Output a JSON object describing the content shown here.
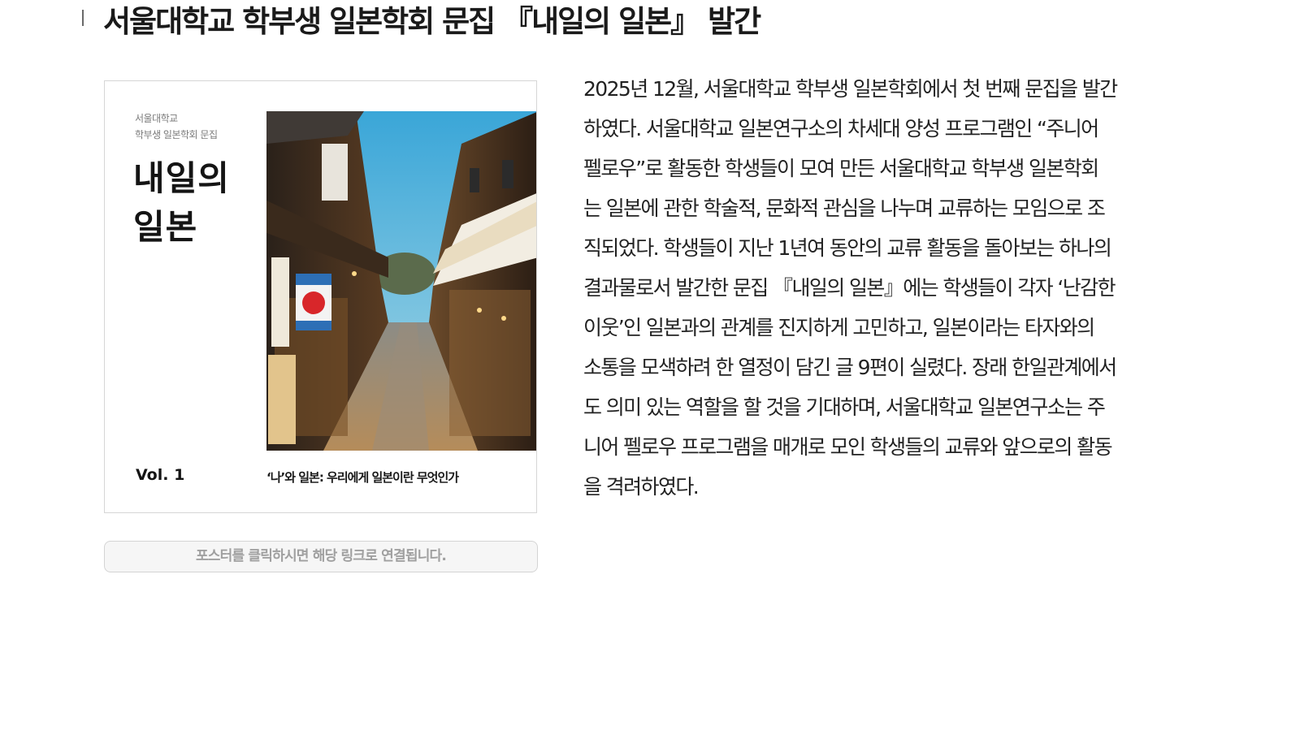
{
  "header": {
    "title": "서울대학교 학부생 일본학회 문집 『내일의 일본』 발간"
  },
  "poster": {
    "university": "서울대학교",
    "club": "학부생 일본학회 문집",
    "title_line1": "내일의",
    "title_line2": "일본",
    "volume": "Vol. 1",
    "subtitle": "‘나’와 일본: 우리에게 일본이란 무엇인가"
  },
  "caption": {
    "text": "포스터를 클릭하시면 해당 링크로 연결됩니다."
  },
  "article": {
    "lines": [
      "2025년 12월, 서울대학교 학부생 일본학회에서 첫 번째 문집을 발간",
      "하였다. 서울대학교 일본연구소의 차세대 양성 프로그램인 “주니어",
      "펠로우”로 활동한 학생들이 모여 만든 서울대학교 학부생 일본학회",
      "는 일본에 관한 학술적, 문화적 관심을 나누며 교류하는 모임으로 조",
      "직되었다. 학생들이 지난 1년여 동안의 교류 활동을 돌아보는 하나의",
      "결과물로서 발간한 문집 『내일의 일본』에는 학생들이 각자 ‘난감한",
      "이웃’인 일본과의 관계를 진지하게 고민하고, 일본이라는 타자와의",
      "소통을 모색하려 한 열정이 담긴 글 9편이 실렸다. 장래 한일관계에서",
      "도 의미 있는 역할을 할 것을 기대하며, 서울대학교 일본연구소는 주",
      "니어 펠로우 프로그램을 매개로 모인 학생들의 교류와 앞으로의 활동",
      "을 격려하였다."
    ]
  },
  "colors": {
    "title_text": "#1a1a1a",
    "caption_bg": "#f6f6f6",
    "caption_text": "#a0a0a0",
    "body_text": "#222222"
  }
}
